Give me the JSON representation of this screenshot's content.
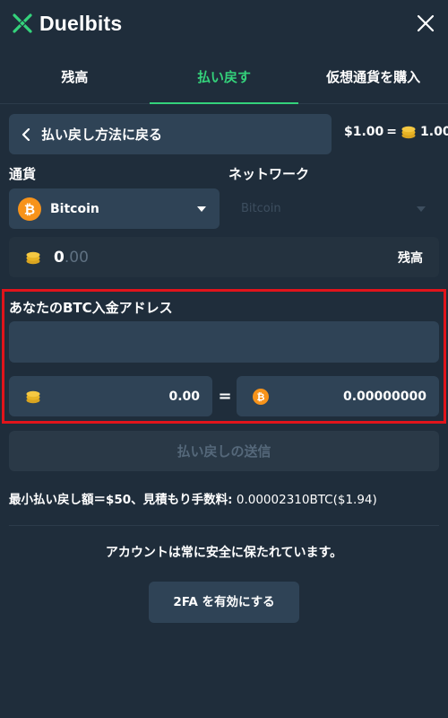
{
  "header": {
    "brand": "Duelbits"
  },
  "tabs": [
    {
      "label": "残高",
      "active": false
    },
    {
      "label": "払い戻す",
      "active": true
    },
    {
      "label": "仮想通貨を購入",
      "active": false
    }
  ],
  "back": {
    "label": "払い戻し方法に戻る"
  },
  "rate": {
    "usd": "$1.00",
    "equals": "=",
    "coins": "1.00"
  },
  "currency": {
    "label": "通貨",
    "selected": "Bitcoin"
  },
  "network": {
    "label": "ネットワーク",
    "selected": "Bitcoin"
  },
  "balance": {
    "whole": "0",
    "decimal": ".00",
    "max_label": "残高"
  },
  "address": {
    "label": "あなたのBTC入金アドレス",
    "value": "",
    "placeholder": ""
  },
  "amounts": {
    "coins": "0.00",
    "equals": "=",
    "btc": "0.00000000"
  },
  "submit": {
    "label": "払い戻しの送信"
  },
  "info": {
    "min_text": "最小払い戻し額＝$50、見積もり手数料:",
    "fee_text": " 0.00002310BTC($1.94)"
  },
  "security": {
    "message": "アカウントは常に安全に保たれています。",
    "twofa_label": "2FA を有効にする"
  },
  "colors": {
    "accent": "#34d27b",
    "background": "#1f2d3b",
    "field": "#2f4356",
    "highlight": "#e1141b",
    "bitcoin": "#f7931a",
    "coin": "#f2c230"
  }
}
